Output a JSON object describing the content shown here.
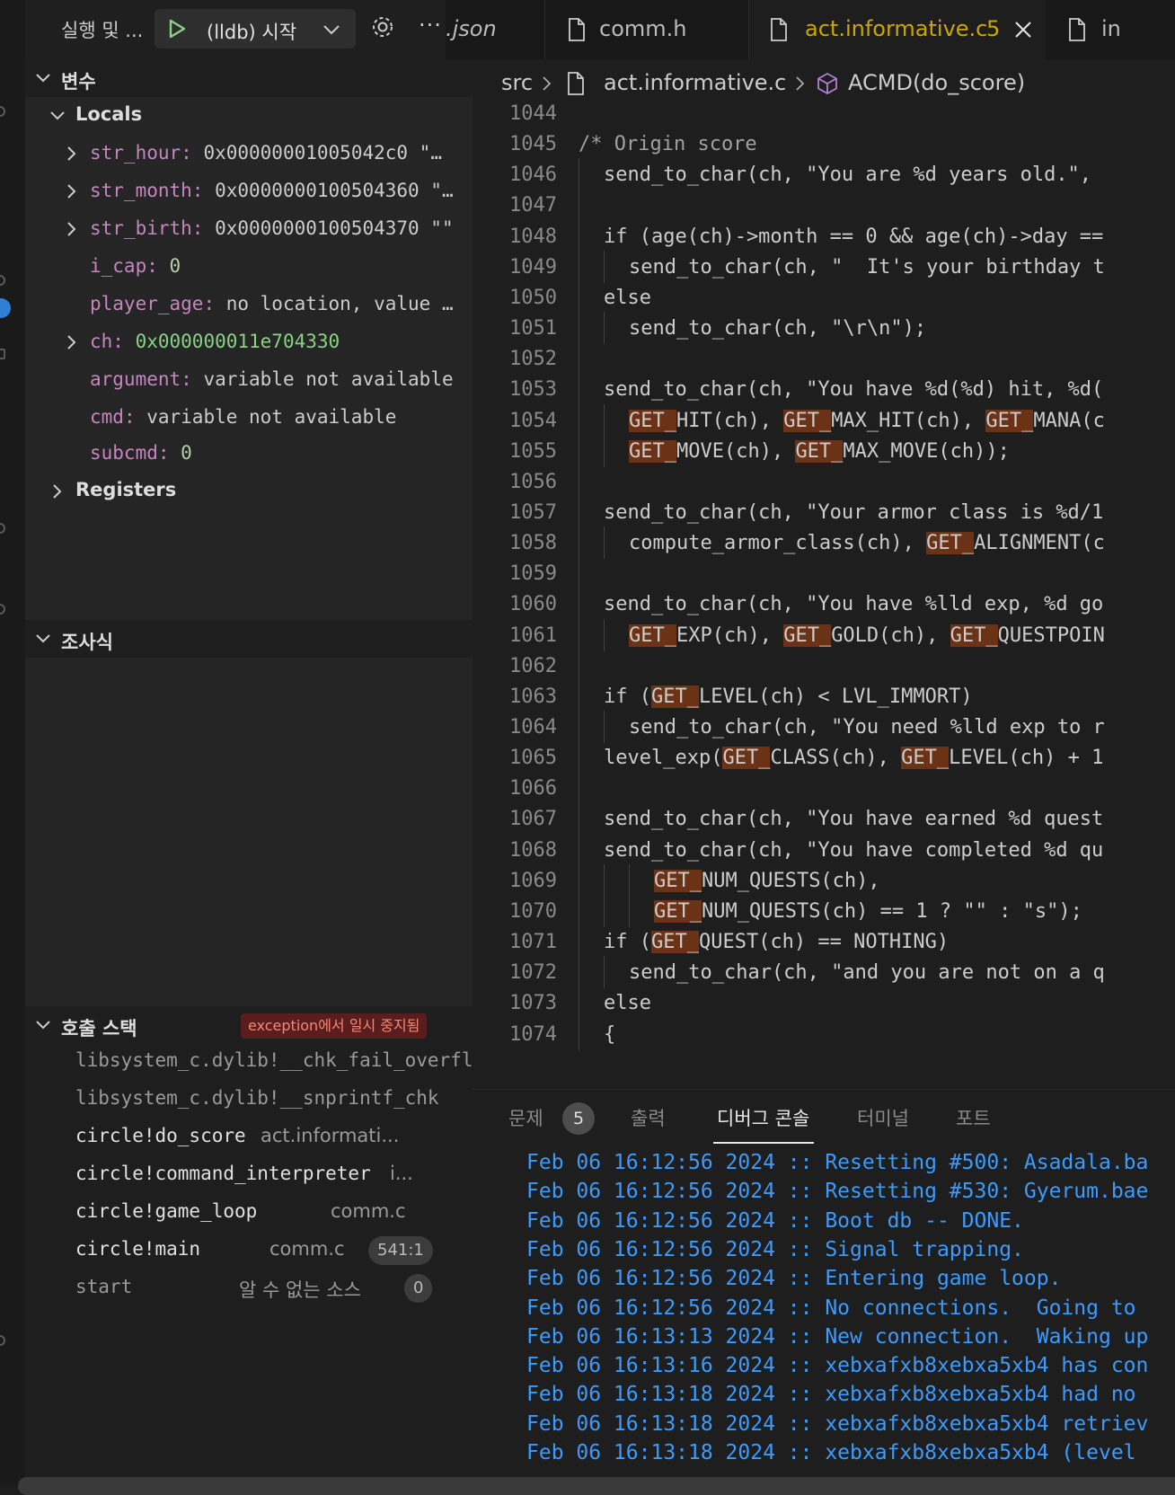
{
  "debug_toolbar": {
    "run_label": "실행 및 ...",
    "launch_config": "(lldb) 시작"
  },
  "variables": {
    "title": "변수",
    "locals_title": "Locals",
    "items": [
      {
        "name": "str_hour",
        "value": "0x00000001005042c0 \"…",
        "expandable": true
      },
      {
        "name": "str_month",
        "value": "0x0000000100504360 \"…",
        "expandable": true
      },
      {
        "name": "str_birth",
        "value": "0x0000000100504370 \"\"",
        "expandable": true
      },
      {
        "name": "i_cap",
        "value": "0",
        "expandable": false
      },
      {
        "name": "player_age",
        "value": "no location, value …",
        "expandable": false
      },
      {
        "name": "ch",
        "value": "0x000000011e704330",
        "expandable": true
      },
      {
        "name": "argument",
        "value": "variable not available",
        "expandable": false
      },
      {
        "name": "cmd",
        "value": "variable not available",
        "expandable": false
      },
      {
        "name": "subcmd",
        "value": "0",
        "expandable": false
      }
    ],
    "registers_title": "Registers"
  },
  "watch": {
    "title": "조사식"
  },
  "call_stack": {
    "title": "호출 스택",
    "status": "exception에서 일시 중지됨",
    "frames": [
      {
        "name": "libsystem_c.dylib!__chk_fail_overflow",
        "source": "",
        "badge": ""
      },
      {
        "name": "libsystem_c.dylib!__snprintf_chk",
        "source": "",
        "badge": ""
      },
      {
        "name": "circle!do_score",
        "source": "act.informati...",
        "badge": ""
      },
      {
        "name": "circle!command_interpreter",
        "source": "i...",
        "badge": ""
      },
      {
        "name": "circle!game_loop",
        "source": "comm.c",
        "badge": ""
      },
      {
        "name": "circle!main",
        "source": "comm.c",
        "badge": "541:1"
      },
      {
        "name": "start",
        "source": "알 수 없는 소스",
        "badge": "0"
      }
    ]
  },
  "tabs": [
    {
      "label": ".json",
      "active": false
    },
    {
      "label": "comm.h",
      "active": false
    },
    {
      "label": "act.informative.c",
      "count": "5",
      "active": true
    },
    {
      "label": "in",
      "active": false
    }
  ],
  "breadcrumb": {
    "folder": "src",
    "file": "act.informative.c",
    "symbol": "ACMD(do_score)"
  },
  "code": [
    {
      "n": "1044",
      "indent": 0,
      "segs": []
    },
    {
      "n": "1045",
      "indent": 0,
      "segs": [
        {
          "t": "/* Origin score",
          "c": "comment"
        }
      ]
    },
    {
      "n": "1046",
      "indent": 1,
      "segs": [
        {
          "t": "send_to_char(ch, \"You are %d years old.\","
        }
      ]
    },
    {
      "n": "1047",
      "indent": 1,
      "segs": []
    },
    {
      "n": "1048",
      "indent": 1,
      "segs": [
        {
          "t": "if (age(ch)->month == 0 && age(ch)->day =="
        }
      ]
    },
    {
      "n": "1049",
      "indent": 2,
      "segs": [
        {
          "t": "send_to_char(ch, \"  It's your birthday t"
        }
      ]
    },
    {
      "n": "1050",
      "indent": 1,
      "segs": [
        {
          "t": "else"
        }
      ]
    },
    {
      "n": "1051",
      "indent": 2,
      "segs": [
        {
          "t": "send_to_char(ch, \"\\r\\n\");"
        }
      ]
    },
    {
      "n": "1052",
      "indent": 1,
      "segs": []
    },
    {
      "n": "1053",
      "indent": 1,
      "segs": [
        {
          "t": "send_to_char(ch, \"You have %d(%d) hit, %d("
        }
      ]
    },
    {
      "n": "1054",
      "indent": 2,
      "segs": [
        {
          "t": "GET_",
          "h": true
        },
        {
          "t": "HIT(ch), "
        },
        {
          "t": "GET_",
          "h": true
        },
        {
          "t": "MAX_HIT(ch), "
        },
        {
          "t": "GET_",
          "h": true
        },
        {
          "t": "MANA(c"
        }
      ]
    },
    {
      "n": "1055",
      "indent": 2,
      "segs": [
        {
          "t": "GET_",
          "h": true
        },
        {
          "t": "MOVE(ch), "
        },
        {
          "t": "GET_",
          "h": true
        },
        {
          "t": "MAX_MOVE(ch));"
        }
      ]
    },
    {
      "n": "1056",
      "indent": 1,
      "segs": []
    },
    {
      "n": "1057",
      "indent": 1,
      "segs": [
        {
          "t": "send_to_char(ch, \"Your armor class is %d/1"
        }
      ]
    },
    {
      "n": "1058",
      "indent": 2,
      "segs": [
        {
          "t": "compute_armor_class(ch), "
        },
        {
          "t": "GET_",
          "h": true
        },
        {
          "t": "ALIGNMENT(c"
        }
      ]
    },
    {
      "n": "1059",
      "indent": 1,
      "segs": []
    },
    {
      "n": "1060",
      "indent": 1,
      "segs": [
        {
          "t": "send_to_char(ch, \"You have %lld exp, %d go"
        }
      ]
    },
    {
      "n": "1061",
      "indent": 2,
      "segs": [
        {
          "t": "GET_",
          "h": true
        },
        {
          "t": "EXP(ch), "
        },
        {
          "t": "GET_",
          "h": true
        },
        {
          "t": "GOLD(ch), "
        },
        {
          "t": "GET_",
          "h": true
        },
        {
          "t": "QUESTPOIN"
        }
      ]
    },
    {
      "n": "1062",
      "indent": 1,
      "segs": []
    },
    {
      "n": "1063",
      "indent": 1,
      "segs": [
        {
          "t": "if ("
        },
        {
          "t": "GET_",
          "h": true
        },
        {
          "t": "LEVEL(ch) < LVL_IMMORT)"
        }
      ]
    },
    {
      "n": "1064",
      "indent": 2,
      "segs": [
        {
          "t": "send_to_char(ch, \"You need %lld exp to r"
        }
      ]
    },
    {
      "n": "1065",
      "indent": 1,
      "segs": [
        {
          "t": "level_exp("
        },
        {
          "t": "GET_",
          "h": true
        },
        {
          "t": "CLASS(ch), "
        },
        {
          "t": "GET_",
          "h": true
        },
        {
          "t": "LEVEL(ch) + 1"
        }
      ]
    },
    {
      "n": "1066",
      "indent": 1,
      "segs": []
    },
    {
      "n": "1067",
      "indent": 1,
      "segs": [
        {
          "t": "send_to_char(ch, \"You have earned %d quest"
        }
      ]
    },
    {
      "n": "1068",
      "indent": 1,
      "segs": [
        {
          "t": "send_to_char(ch, \"You have completed %d qu"
        }
      ]
    },
    {
      "n": "1069",
      "indent": 3,
      "segs": [
        {
          "t": "GET_",
          "h": true
        },
        {
          "t": "NUM_QUESTS(ch),"
        }
      ]
    },
    {
      "n": "1070",
      "indent": 3,
      "segs": [
        {
          "t": "GET_",
          "h": true
        },
        {
          "t": "NUM_QUESTS(ch) == 1 ? \"\" : \"s\");"
        }
      ]
    },
    {
      "n": "1071",
      "indent": 1,
      "segs": [
        {
          "t": "if ("
        },
        {
          "t": "GET_",
          "h": true
        },
        {
          "t": "QUEST(ch) == NOTHING)"
        }
      ]
    },
    {
      "n": "1072",
      "indent": 2,
      "segs": [
        {
          "t": "send_to_char(ch, \"and you are not on a q"
        }
      ]
    },
    {
      "n": "1073",
      "indent": 1,
      "segs": [
        {
          "t": "else"
        }
      ]
    },
    {
      "n": "1074",
      "indent": 1,
      "segs": [
        {
          "t": "{"
        }
      ]
    }
  ],
  "panel": {
    "tabs": [
      {
        "label": "문제",
        "badge": "5",
        "active": false
      },
      {
        "label": "출력",
        "active": false
      },
      {
        "label": "디버그 콘솔",
        "active": true
      },
      {
        "label": "터미널",
        "active": false
      },
      {
        "label": "포트",
        "active": false
      }
    ],
    "console": [
      "Feb 06 16:12:56 2024 :: Resetting #500: Asadala.ba",
      "Feb 06 16:12:56 2024 :: Resetting #530: Gyerum.bae",
      "Feb 06 16:12:56 2024 :: Boot db -- DONE.",
      "Feb 06 16:12:56 2024 :: Signal trapping.",
      "Feb 06 16:12:56 2024 :: Entering game loop.",
      "Feb 06 16:12:56 2024 :: No connections.  Going to",
      "Feb 06 16:13:13 2024 :: New connection.  Waking up",
      "Feb 06 16:13:16 2024 :: xebxafxb8xebxa5xb4 has con",
      "Feb 06 16:13:18 2024 :: xebxafxb8xebxa5xb4 had no",
      "Feb 06 16:13:18 2024 :: xebxafxb8xebxa5xb4 retriev",
      "Feb 06 16:13:18 2024 :: xebxafxb8xebxa5xb4 (level"
    ]
  },
  "colors": {
    "active_tab_text": "#cca700",
    "macro_highlight": "#6b3215",
    "console_text": "#3b9bff",
    "variable_name": "#c586c0",
    "exception_badge_bg": "#5a1d1d"
  }
}
